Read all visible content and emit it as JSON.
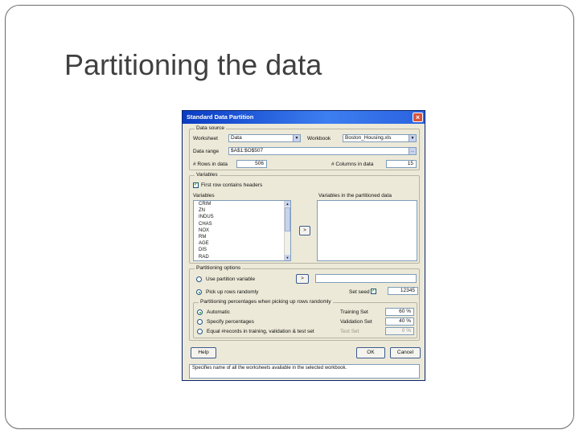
{
  "slide": {
    "title": "Partitioning the data"
  },
  "dialog": {
    "title": "Standard Data Partition",
    "close_icon": "close-icon",
    "data_source": {
      "legend": "Data source",
      "worksheet_label": "Worksheet",
      "worksheet_value": "Data",
      "workbook_label": "Workbook",
      "workbook_value": "Boston_Housing.xls",
      "data_range_label": "Data range",
      "data_range_value": "$A$1:$O$507",
      "rows_label": "# Rows in data",
      "rows_value": "506",
      "columns_label": "# Columns in data",
      "columns_value": "15"
    },
    "variables": {
      "legend": "Variables",
      "first_row_headers_label": "First row contains headers",
      "first_row_headers_checked": true,
      "variables_label": "Variables",
      "variables_list": [
        "CRIM",
        "ZN",
        "INDUS",
        "CHAS",
        "NOX",
        "RM",
        "AGE",
        "DIS",
        "RAD"
      ],
      "partitioned_label": "Variables in the partitioned data",
      "move_button": ">"
    },
    "partitioning_options": {
      "legend": "Partitioning options",
      "use_partition_label": "Use partition variable",
      "partition_button": ">",
      "pick_random_label": "Pick up rows randomly",
      "set_seed_label": "Set seed",
      "seed_checked": true,
      "seed_value": "12345"
    },
    "percentages": {
      "legend": "Partitioning percentages when picking up rows randomly",
      "automatic_label": "Automatic",
      "specify_label": "Specify percentages",
      "equal_label": "Equal #records in training, validation & test set",
      "training_label": "Training Set",
      "training_value": "60 %",
      "validation_label": "Validation Set",
      "validation_value": "40 %",
      "test_label": "Test Set",
      "test_value": "0 %"
    },
    "buttons": {
      "help": "Help",
      "ok": "OK",
      "cancel": "Cancel"
    },
    "status_text": "Specifies name of all the worksheets available in the selected workbook."
  }
}
